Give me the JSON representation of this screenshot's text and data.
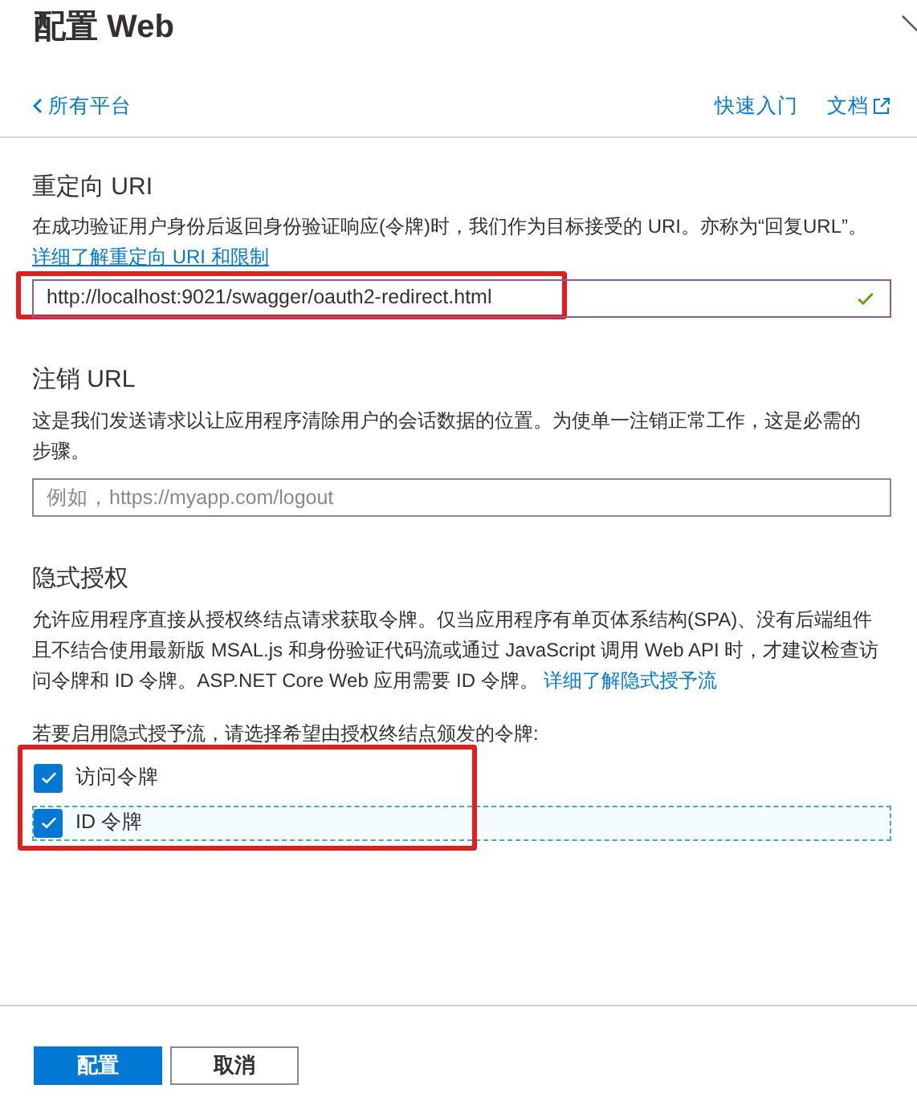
{
  "panel": {
    "title": "配置 Web"
  },
  "nav": {
    "back_link": "所有平台",
    "links": [
      {
        "label": "快速入门",
        "external": false
      },
      {
        "label": "文档",
        "external": true
      }
    ]
  },
  "redirect": {
    "heading": "重定向 URI",
    "description": "在成功验证用户身份后返回身份验证响应(令牌)时，我们作为目标接受的 URI。亦称为“回复URL”。",
    "link": "详细了解重定向 URI 和限制",
    "value": "http://localhost:9021/swagger/oauth2-redirect.html",
    "valid": true,
    "highlighted": true
  },
  "logout": {
    "heading": "注销 URL",
    "description": "这是我们发送请求以让应用程序清除用户的会话数据的位置。为使单一注销正常工作，这是必需的步骤。",
    "placeholder": "例如，https://myapp.com/logout"
  },
  "implicit": {
    "heading": "隐式授权",
    "description": "允许应用程序直接从授权终结点请求获取令牌。仅当应用程序有单页体系结构(SPA)、没有后端组件且不结合使用最新版 MSAL.js 和身份验证代码流或通过 JavaScript 调用 Web API 时，才建议检查访问令牌和 ID 令牌。ASP.NET Core Web 应用需要 ID 令牌。",
    "link": "详细了解隐式授予流",
    "prompt": "若要启用隐式授予流，请选择希望由授权终结点颁发的令牌:",
    "highlighted": true,
    "options": [
      {
        "label": "访问令牌",
        "checked": true,
        "focused": false
      },
      {
        "label": "ID 令牌",
        "checked": true,
        "focused": true
      }
    ]
  },
  "buttons": [
    {
      "label": "配置",
      "kind": "primary"
    },
    {
      "label": "取消",
      "kind": "secondary"
    }
  ]
}
